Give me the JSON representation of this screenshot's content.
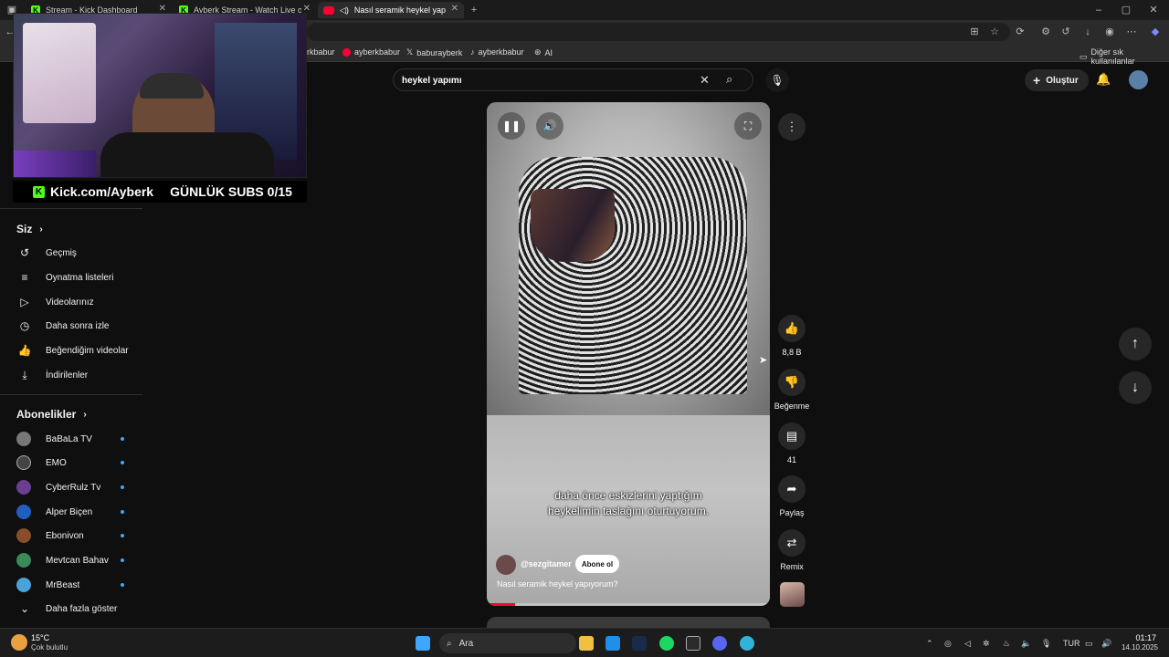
{
  "browser": {
    "tabs": [
      {
        "title": "Stream - Kick Dashboard"
      },
      {
        "title": "Ayberk Stream - Watch Live on Ki"
      },
      {
        "title": "Nasıl seramik heykel yapıyor"
      }
    ],
    "bookmarks": [
      {
        "label": "rkbabur"
      },
      {
        "label": "ayberkbabur"
      },
      {
        "label": "baburayberk"
      },
      {
        "label": "ayberkbabur"
      },
      {
        "label": "AI"
      }
    ],
    "other_bookmarks": "Diğer sık kullanılanlar"
  },
  "overlay": {
    "kick_text": "Kick.com/Ayberk",
    "subs_text": "GÜNLÜK SUBS 0/15"
  },
  "search": {
    "value": "heykel yapımı"
  },
  "header": {
    "create_label": "Oluştur"
  },
  "sidebar": {
    "you_heading": "Siz",
    "items": [
      {
        "label": "Geçmiş",
        "icon": "history-icon"
      },
      {
        "label": "Oynatma listeleri",
        "icon": "playlist-icon"
      },
      {
        "label": "Videolarınız",
        "icon": "video-icon"
      },
      {
        "label": "Daha sonra izle",
        "icon": "clock-icon"
      },
      {
        "label": "Beğendiğim videolar",
        "icon": "thumbs-up-icon"
      },
      {
        "label": "İndirilenler",
        "icon": "download-icon"
      }
    ],
    "subs_heading": "Abonelikler",
    "subscriptions": [
      {
        "name": "BaBaLa TV",
        "color": "#777777"
      },
      {
        "name": "EMO",
        "color": "#444444"
      },
      {
        "name": "CyberRulz Tv",
        "color": "#6b3f8f"
      },
      {
        "name": "Alper Biçen",
        "color": "#1f5fbf"
      },
      {
        "name": "Ebonivon",
        "color": "#8a4d2b"
      },
      {
        "name": "Mevtcan Bahav",
        "color": "#3a8a5a"
      },
      {
        "name": "MrBeast",
        "color": "#4aa3d8"
      }
    ],
    "show_more": "Daha fazla göster"
  },
  "short": {
    "caption_line1": "daha önce eskizlerini yaptığım",
    "caption_line2": "heykelimin taslağını oturtuyorum.",
    "channel": "@sezgitamer",
    "subscribe_label": "Abone ol",
    "title": "Nasıl seramik heykel yapıyorum?",
    "progress": 0.1
  },
  "actions": {
    "like_count": "8,8 B",
    "dislike_label": "Beğenme",
    "comment_count": "41",
    "share_label": "Paylaş",
    "remix_label": "Remix"
  },
  "taskbar": {
    "weather_temp": "15°C",
    "weather_desc": "Çok bulutlu",
    "search_label": "Ara",
    "language": "TUR",
    "time": "01:17",
    "date": "14.10.2025"
  }
}
